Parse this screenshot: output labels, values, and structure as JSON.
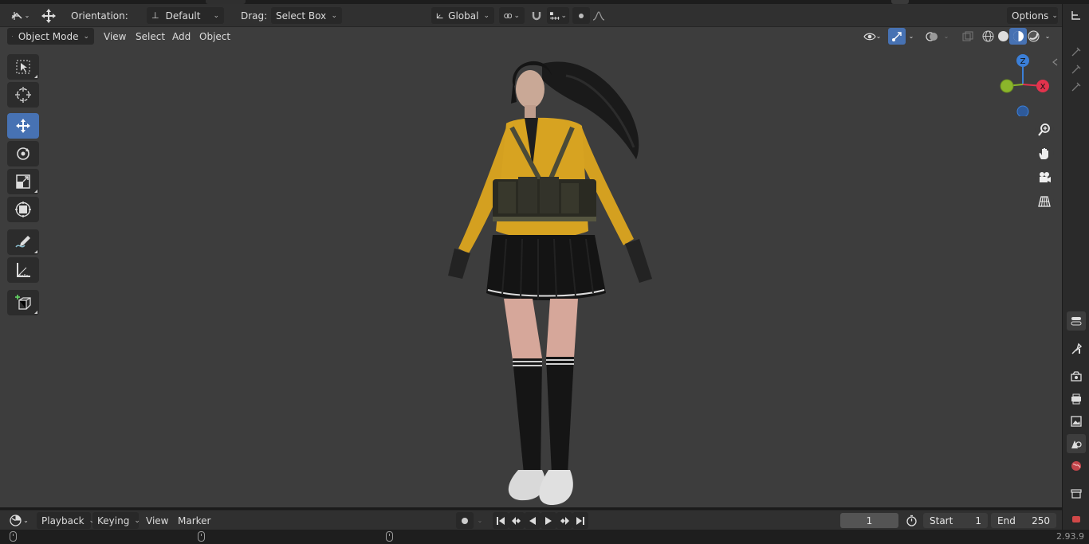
{
  "tool_header": {
    "orientation_label": "Orientation:",
    "orientation_value": "Default",
    "drag_label": "Drag:",
    "drag_value": "Select Box",
    "transform_orientation": "Global",
    "options_label": "Options"
  },
  "viewport_header": {
    "mode": "Object Mode",
    "menus": [
      "View",
      "Select",
      "Add",
      "Object"
    ]
  },
  "toolbar": {
    "tools": [
      "select-box",
      "cursor",
      "move",
      "rotate",
      "scale",
      "transform",
      "annotate",
      "measure",
      "add-cube"
    ],
    "active": "move"
  },
  "gizmo": {
    "z": "Z",
    "x": "X"
  },
  "timeline": {
    "menus": [
      "Playback",
      "Keying",
      "View",
      "Marker"
    ],
    "current_frame": "1",
    "start_label": "Start",
    "start_value": "1",
    "end_label": "End",
    "end_value": "250"
  },
  "status": {
    "version": "2.93.9"
  },
  "colors": {
    "accent": "#4772b3",
    "viewport_bg": "#3d3d3d",
    "header_bg": "#303030",
    "axis_x": "#e2334d",
    "axis_y": "#8bb62b",
    "axis_z": "#3b7fd8"
  }
}
